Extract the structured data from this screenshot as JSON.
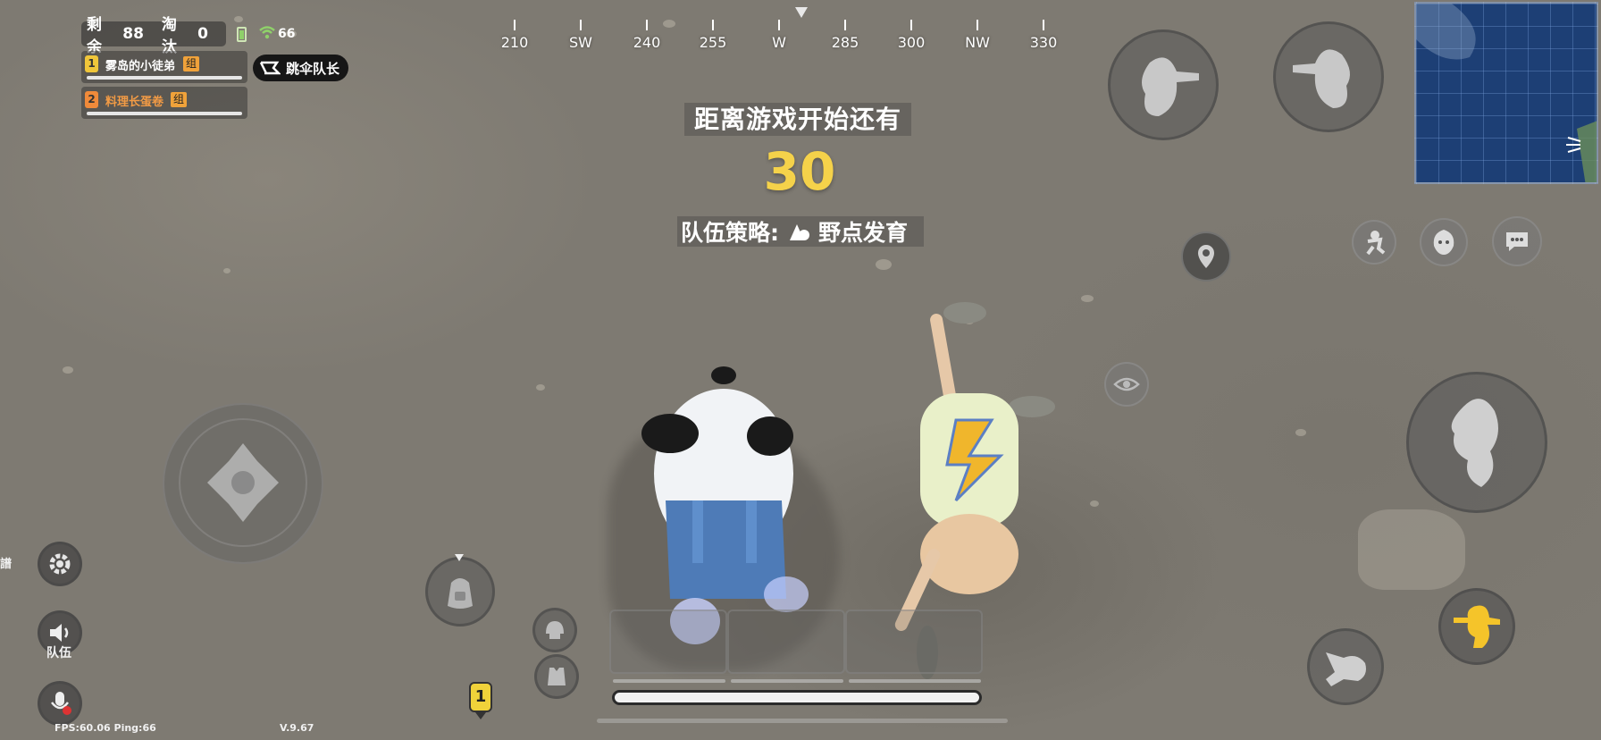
{
  "hud": {
    "remaining_label": "剩余",
    "remaining_value": "88",
    "eliminated_label": "淘汰",
    "eliminated_value": "0",
    "signal_ping": "66"
  },
  "team": {
    "members": [
      {
        "index": "1",
        "name": "雾岛的小徒弟",
        "tag": "组"
      },
      {
        "index": "2",
        "name": "料理长蛋卷",
        "tag": "组"
      }
    ],
    "jumpmaster_label": "跳伞队长"
  },
  "compass": {
    "labels": [
      "210",
      "SW",
      "240",
      "255",
      "W",
      "285",
      "300",
      "NW",
      "330"
    ]
  },
  "countdown": {
    "title": "距离游戏开始还有",
    "value": "30",
    "strategy_label": "队伍策略:",
    "strategy_value": "野点发育"
  },
  "controls": {
    "team_voice_label": "队伍",
    "side_label": "譜",
    "marker_number": "1"
  },
  "footer": {
    "fps_ping": "FPS:60.06 Ping:66",
    "version": "V.9.67"
  },
  "colors": {
    "countdown": "#f5d24a",
    "member1": "#f0c63a",
    "member2": "#f08a3a",
    "active_button": "#f5c42a",
    "minimap": "#1d3f75"
  },
  "icons": [
    "battery-icon",
    "wifi-icon",
    "parachute-icon",
    "location-pin-icon",
    "eye-icon",
    "emote-icon",
    "face-icon",
    "chat-icon",
    "settings-icon",
    "speaker-icon",
    "mic-off-icon",
    "backpack-icon",
    "helmet-icon",
    "vest-icon"
  ]
}
